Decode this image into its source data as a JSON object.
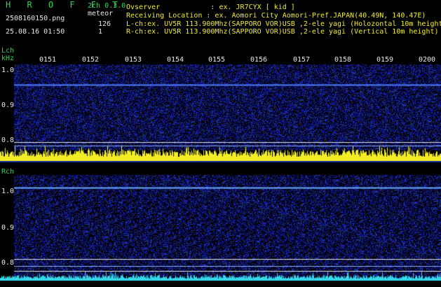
{
  "header": {
    "app_title": "H R O F F T",
    "version": "2ch 0.3.0",
    "filename": "2508160150.png",
    "datetime": "25.08.16 01:50",
    "meteor_label": "meteor",
    "meteor_l_count": "126",
    "meteor_r_count": "1",
    "observer_line": "Ovserver            : ex. JR7CYX [ kid ]",
    "location_line": "Receiving Location : ex. Aomori City Aomori-Pref.JAPAN(40.49N, 140.47E)",
    "lch_line": "L-ch:ex. UV5R 113.900Mhz(SAPPORO VOR)USB ,2-ele yagi (Holozontal 10m height",
    "rch_line": "R-ch:ex. UV5R 113.900Mhz(SAPPORO VOR)USB ,2-ele yagi (Vertical 10m height)"
  },
  "lch_panel": {
    "channel_label": "Lch",
    "unit_label": "kHz",
    "time_ticks": [
      "0151",
      "0152",
      "0153",
      "0154",
      "0155",
      "0156",
      "0157",
      "0158",
      "0159",
      "0200"
    ],
    "freq_ticks": [
      "1.0",
      "0.9",
      "0.8"
    ]
  },
  "rch_panel": {
    "channel_label": "Rch",
    "freq_ticks": [
      "1.0",
      "0.9",
      "0.8"
    ]
  },
  "colors": {
    "background": "#000000",
    "noise_blue": "#1a1fa8",
    "carrier_line": "#6aa8ff",
    "label_green": "#27d850",
    "label_white": "#e8e8e8",
    "lch_activity": "#f2ee25",
    "rch_activity": "#35d8e8"
  }
}
